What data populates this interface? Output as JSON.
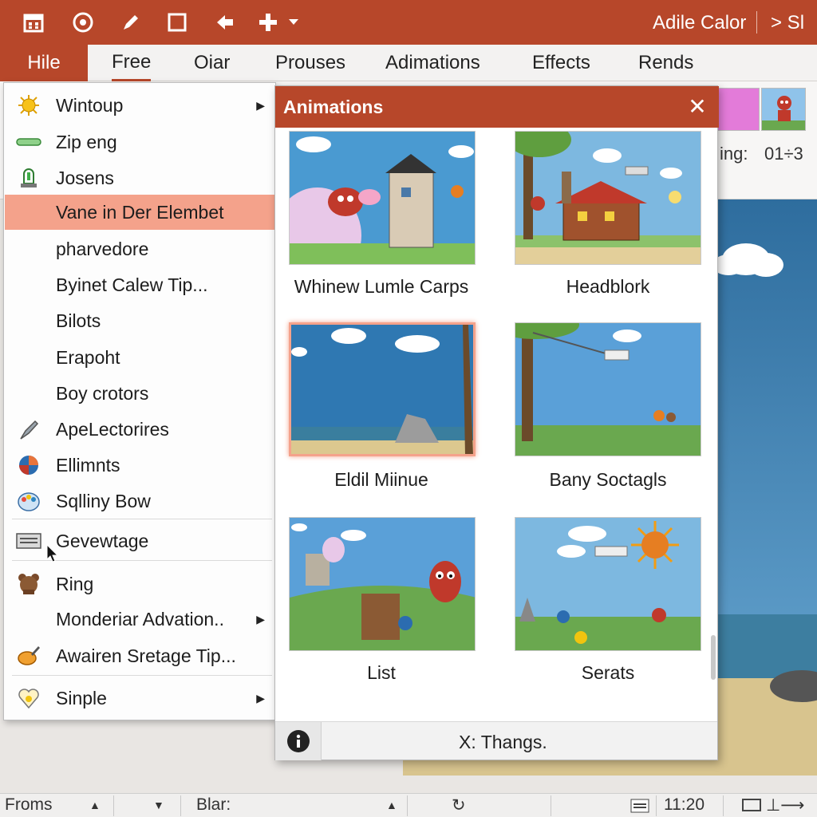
{
  "titlebar": {
    "app_title": "Adile Calor",
    "user": "> Sl",
    "quick_access_icons": [
      "calendar-icon",
      "record-icon",
      "pen-icon",
      "square-icon",
      "undo-icon",
      "add-icon",
      "dropdown-icon"
    ]
  },
  "ribbon": {
    "file_tab": "Hile",
    "tabs": [
      "Free",
      "Oiar",
      "Prouses",
      "Adimations",
      "Effects",
      "Rends"
    ],
    "timing_label": "ing:",
    "timing_value": "01÷3"
  },
  "menu": {
    "items": [
      {
        "label": "Wintoup",
        "icon": "sun-icon",
        "submenu": true
      },
      {
        "label": "Zip eng",
        "icon": "bar-icon",
        "submenu": false
      },
      {
        "label": "Josens",
        "icon": "lamp-icon",
        "submenu": false
      },
      {
        "label": "Vane in Der Elembet",
        "icon": "",
        "submenu": false,
        "highlighted": true
      },
      {
        "label": "pharvedore",
        "icon": "",
        "submenu": false
      },
      {
        "label": "Byinet Calew Tip...",
        "icon": "",
        "submenu": false
      },
      {
        "label": "Bilots",
        "icon": "",
        "submenu": false
      },
      {
        "label": "Erapoht",
        "icon": "",
        "submenu": false
      },
      {
        "label": "Boy crotors",
        "icon": "",
        "submenu": false
      },
      {
        "label": "ApeLectorires",
        "icon": "brush-icon",
        "submenu": false
      },
      {
        "label": "Ellimnts",
        "icon": "ball-icon",
        "submenu": false
      },
      {
        "label": "Sqlliny Bow",
        "icon": "palette-icon",
        "submenu": false
      },
      {
        "label": "Gevewtage",
        "icon": "keyboard-icon",
        "submenu": false
      },
      {
        "label": "Ring",
        "icon": "bear-icon",
        "submenu": false
      },
      {
        "label": "Monderiar Advation..",
        "icon": "",
        "submenu": true
      },
      {
        "label": "Awairen Sretage Tip...",
        "icon": "paint-icon",
        "submenu": false
      },
      {
        "label": "Sinple",
        "icon": "heart-icon",
        "submenu": true
      }
    ]
  },
  "panel": {
    "title": "Animations",
    "tiles": [
      {
        "caption": "Whinew Lumle Carps",
        "selected": false
      },
      {
        "caption": "Headblork",
        "selected": false
      },
      {
        "caption": "Eldil Miinue",
        "selected": true
      },
      {
        "caption": "Bany Soctagls",
        "selected": false
      },
      {
        "caption": "List",
        "selected": false
      },
      {
        "caption": "Serats",
        "selected": false
      }
    ],
    "footer_text": "X: Thangs."
  },
  "statusbar": {
    "left": "Froms",
    "mid": "Blar:",
    "time": "11:20"
  },
  "colors": {
    "accent": "#b7472a",
    "highlight": "#f4a28b",
    "sky": "#3f7fb0",
    "grass": "#6aa84f"
  }
}
